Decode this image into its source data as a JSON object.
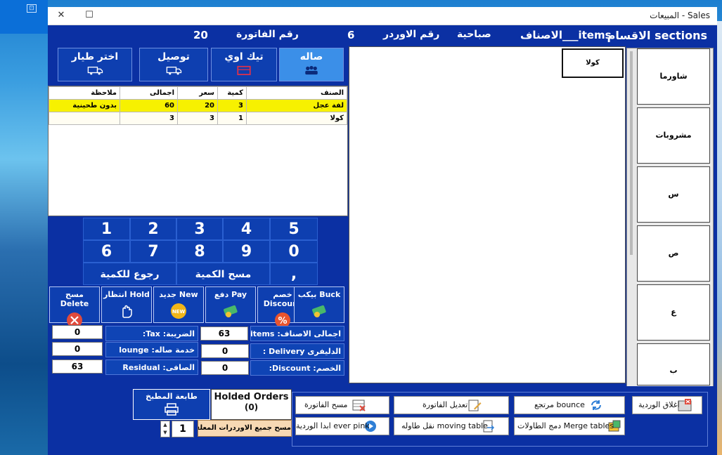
{
  "window": {
    "title": "المبيعات - Sales",
    "minimize_icon": "minimize-icon",
    "close_icon": "close-icon"
  },
  "desktop": {
    "icon": "desktop-window-icon"
  },
  "header": {
    "sections_label": "الاقسام sections",
    "items_label": "الاصناف___items",
    "shift": "صباحية",
    "order_label": "رقم الاوردر",
    "order_no": "6",
    "invoice_label": "رقم الفاتورة",
    "invoice_no": "20"
  },
  "order_types": [
    {
      "label": "صاله",
      "icon": "people-icon"
    },
    {
      "label": "تيك اوي",
      "icon": "takeaway-icon"
    },
    {
      "label": "توصيل",
      "icon": "delivery-truck-icon"
    },
    {
      "label": "اختر طيار",
      "icon": "driver-truck-icon"
    }
  ],
  "grid": {
    "columns": [
      "الصنف",
      "كمية",
      "سعر",
      "اجمالى",
      "ملاحظة"
    ],
    "rows": [
      [
        "لفة عجل",
        "3",
        "20",
        "60",
        "بدون طحينية"
      ],
      [
        "كولا",
        "1",
        "3",
        "3",
        ""
      ]
    ]
  },
  "numpad": {
    "row1": [
      "1",
      "2",
      "3",
      "4",
      "5"
    ],
    "row2": [
      "6",
      "7",
      "8",
      "9",
      "0"
    ],
    "back_label": "رجوع للكمية",
    "clear_label": "مسح الكمية",
    "comma_label": ","
  },
  "actions": [
    {
      "label": "مسح Delete",
      "icon": "delete-x-icon"
    },
    {
      "label": "انتظار Hold",
      "icon": "hand-stop-icon"
    },
    {
      "label": "جديد New",
      "icon": "new-badge-icon"
    },
    {
      "label": "دفع Pay",
      "icon": "money-icon"
    },
    {
      "label": "خصم Discount",
      "icon": "percent-icon"
    },
    {
      "label": "بيكب Buck",
      "icon": "money-back-icon"
    }
  ],
  "totals": {
    "total_items_label": "اجمالى الاصناف: Total items",
    "total_items_value": "63",
    "tax_label": "الضريبة: Tax:",
    "tax_value": "0",
    "delivery_label": "الدليفرى Delivery :",
    "delivery_value": "0",
    "lounge_label": "خدمة صاله: lounge",
    "lounge_value": "0",
    "discount_label": "الخصم: Discount:",
    "discount_value": "0",
    "residual_label": "الصافى: Residual",
    "residual_value": "63"
  },
  "items": [
    {
      "label": "كولا"
    }
  ],
  "sections": [
    {
      "label": "شاورما"
    },
    {
      "label": "مشروبات"
    },
    {
      "label": "س"
    },
    {
      "label": "ص"
    },
    {
      "label": "ع"
    },
    {
      "label": "ب"
    }
  ],
  "bottom": {
    "kitchen_printer": "طابعة المطبخ",
    "holded_orders": "Holded Orders",
    "holded_count": "(0)",
    "qty_value": "1",
    "clear_hold_label": "مسح جميع الاوردرات المعلقة",
    "buttons": [
      {
        "label": "اغلاق الوردية",
        "icon": "close-shift-icon"
      },
      {
        "label": "مرتجع bounce",
        "icon": "refresh-icon"
      },
      {
        "label": "تعديل الفاتورة",
        "icon": "edit-invoice-icon"
      },
      {
        "label": "مسح الفاتورة",
        "icon": "delete-invoice-icon"
      },
      {
        "label": "دمج الطاولات Merge tables",
        "icon": "merge-tables-icon"
      },
      {
        "label": "نقل طاوله moving table",
        "icon": "move-table-icon"
      },
      {
        "label": "ابدا الوردية ever pink",
        "icon": "play-icon"
      }
    ]
  },
  "colors": {
    "window_bg": "#0b30a3",
    "highlight_row": "#f7f100",
    "active_tab": "#3b8fe8"
  }
}
